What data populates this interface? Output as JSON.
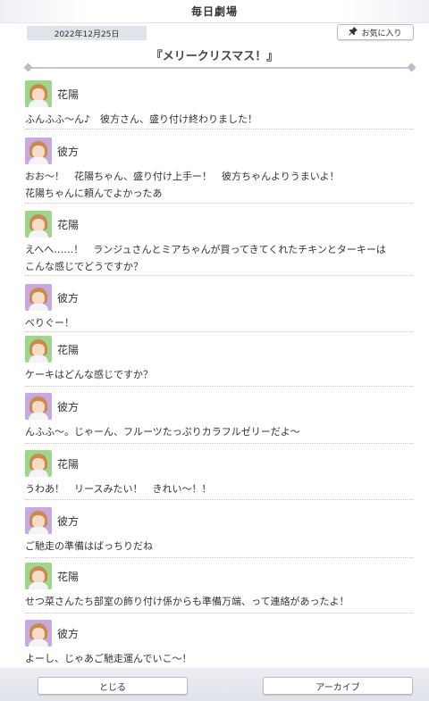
{
  "header": {
    "title": "毎日劇場"
  },
  "date": "2022年12月25日",
  "favorite_button": {
    "label": "お気に入り",
    "icon": "pin-icon"
  },
  "scene_title": "『メリークリスマス！』",
  "messages": [
    {
      "speaker": "花陽",
      "avatar": "green",
      "text": "ふんふふ〜ん♪　彼方さん、盛り付け終わりました！"
    },
    {
      "speaker": "彼方",
      "avatar": "purple",
      "text": "おお〜！　花陽ちゃん、盛り付け上手ー！　彼方ちゃんよりうまいよ！\n花陽ちゃんに頼んでよかったあ"
    },
    {
      "speaker": "花陽",
      "avatar": "green",
      "text": "えへへ……！　ランジュさんとミアちゃんが買ってきてくれたチキンとターキーは\nこんな感じでどうですか？"
    },
    {
      "speaker": "彼方",
      "avatar": "purple",
      "text": "べりぐー！"
    },
    {
      "speaker": "花陽",
      "avatar": "green",
      "text": "ケーキはどんな感じですか？"
    },
    {
      "speaker": "彼方",
      "avatar": "purple",
      "text": "んふふ〜。じゃーん、フルーツたっぷりカラフルゼリーだよ〜"
    },
    {
      "speaker": "花陽",
      "avatar": "green",
      "text": "うわあ！　リースみたい！　きれい〜！！"
    },
    {
      "speaker": "彼方",
      "avatar": "purple",
      "text": "ご馳走の準備はばっちりだね"
    },
    {
      "speaker": "花陽",
      "avatar": "green",
      "text": "せつ菜さんたち部室の飾り付け係からも準備万端、って連絡があったよ！"
    },
    {
      "speaker": "彼方",
      "avatar": "purple",
      "text": "よーし、じゃあご馳走運んでいこ〜！"
    }
  ],
  "footer": {
    "close_label": "とじる",
    "archive_label": "アーカイブ"
  }
}
